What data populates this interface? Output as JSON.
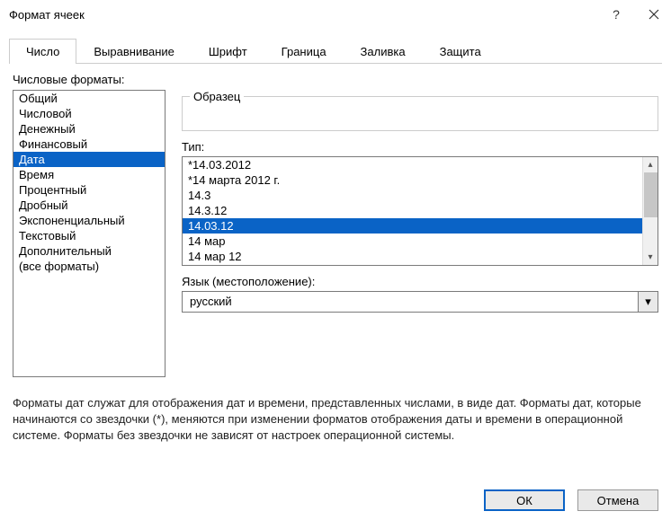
{
  "title": "Формат ячеек",
  "tabs": [
    "Число",
    "Выравнивание",
    "Шрифт",
    "Граница",
    "Заливка",
    "Защита"
  ],
  "active_tab": 0,
  "categories_label": "Числовые форматы:",
  "categories": [
    "Общий",
    "Числовой",
    "Денежный",
    "Финансовый",
    "Дата",
    "Время",
    "Процентный",
    "Дробный",
    "Экспоненциальный",
    "Текстовый",
    "Дополнительный",
    "(все форматы)"
  ],
  "selected_category": 4,
  "sample_label": "Образец",
  "type_label": "Тип:",
  "types": [
    "*14.03.2012",
    "*14 марта 2012 г.",
    "14.3",
    "14.3.12",
    "14.03.12",
    "14 мар",
    "14 мар 12"
  ],
  "selected_type": 4,
  "locale_label": "Язык (местоположение):",
  "locale_value": "русский",
  "description": "Форматы дат служат для отображения дат и времени, представленных числами, в виде дат. Форматы дат, которые начинаются со звездочки (*), меняются при изменении форматов отображения даты и времени в операционной системе. Форматы без звездочки не зависят от настроек операционной системы.",
  "ok_label": "ОК",
  "cancel_label": "Отмена",
  "help_label": "?"
}
